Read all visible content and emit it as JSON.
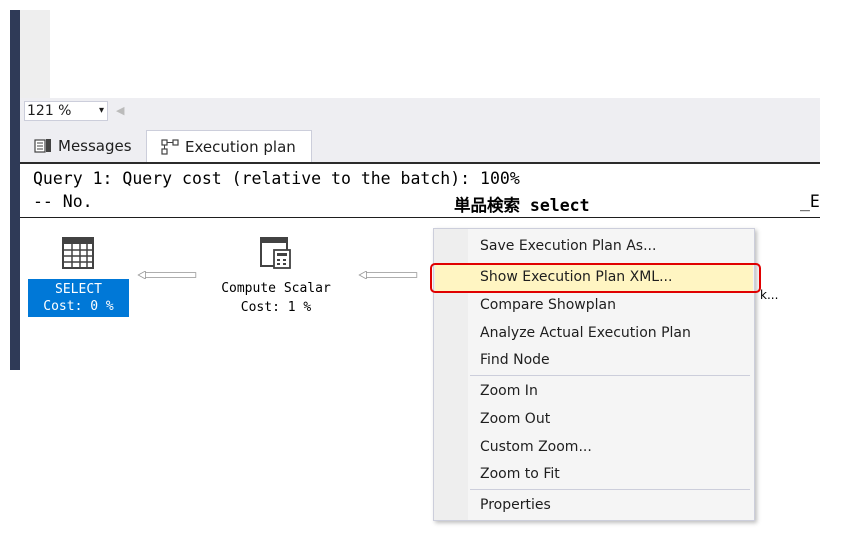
{
  "toolbar": {
    "zoom_value": "121 %",
    "zoom_dropdown_glyph": "▾",
    "scroll_left_glyph": "◀"
  },
  "tabs": [
    {
      "label": "Messages",
      "icon": "messages-icon",
      "active": false
    },
    {
      "label": "Execution plan",
      "icon": "execution-plan-icon",
      "active": true
    }
  ],
  "plan": {
    "query_header": "Query 1: Query cost (relative to the batch): 100%",
    "query_text_prefix": "-- No.",
    "query_text_middle": "単品検索 select",
    "query_text_suffix": "_E",
    "operators": [
      {
        "name": "SELECT",
        "cost": "Cost: 0 %",
        "icon": "select-result-icon",
        "selected": true
      },
      {
        "name": "Compute Scalar",
        "cost": "Cost: 1 %",
        "icon": "compute-scalar-icon",
        "selected": false
      }
    ],
    "truncated_label": "k..."
  },
  "context_menu": {
    "items": [
      {
        "label": "Save Execution Plan As..."
      },
      {
        "label": "Show Execution Plan XML...",
        "highlighted": true
      },
      {
        "label": "Compare Showplan"
      },
      {
        "label": "Analyze Actual Execution Plan"
      },
      {
        "label": "Find Node"
      },
      {
        "label": "Zoom In"
      },
      {
        "label": "Zoom Out"
      },
      {
        "label": "Custom Zoom..."
      },
      {
        "label": "Zoom to Fit"
      },
      {
        "label": "Properties"
      }
    ]
  },
  "colors": {
    "selection_blue": "#0078d7",
    "highlight_red": "#e00000",
    "menu_hover": "#fff5c2",
    "sidebar_dark": "#2f3a57"
  }
}
